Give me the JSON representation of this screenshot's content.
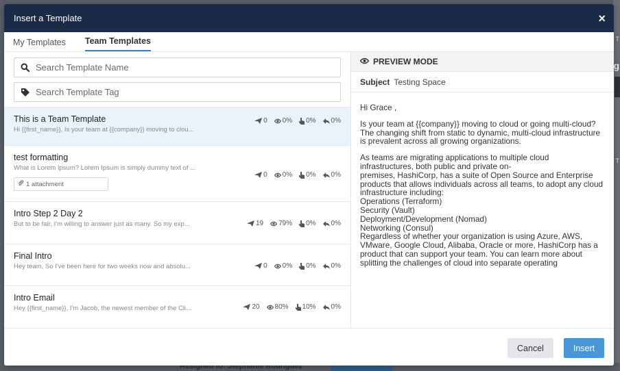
{
  "background": {
    "assigned_text": "Assigned to: Stephanie Rodriguez",
    "edge_letters": [
      "T",
      "g",
      "T"
    ]
  },
  "modal": {
    "title": "Insert a Template",
    "close_label": "×"
  },
  "tabs": [
    {
      "label": "My Templates",
      "active": false
    },
    {
      "label": "Team Templates",
      "active": true
    }
  ],
  "search": {
    "name_placeholder": "Search Template Name",
    "tag_placeholder": "Search Template Tag"
  },
  "templates": [
    {
      "title": "This is a Team Template",
      "preview": "Hi {{first_name}}, Is your team at {{company}} moving to clou...",
      "sent": "0",
      "opened": "0%",
      "clicked": "0%",
      "replied": "0%",
      "selected": true,
      "attachment": ""
    },
    {
      "title": "test formatting",
      "preview": "What is Lorem Ipsum? Lorem Ipsum is simply dummy text of ...",
      "sent": "0",
      "opened": "0%",
      "clicked": "0%",
      "replied": "0%",
      "selected": false,
      "attachment": "1 attachment"
    },
    {
      "title": "Intro Step 2 Day 2",
      "preview": "But to be fair, I'm willing to answer just as many.  So my exp...",
      "sent": "19",
      "opened": "79%",
      "clicked": "0%",
      "replied": "0%",
      "selected": false,
      "attachment": ""
    },
    {
      "title": "Final Intro",
      "preview": "Hey team, So I've been here for two weeks now and absolu...",
      "sent": "0",
      "opened": "0%",
      "clicked": "0%",
      "replied": "0%",
      "selected": false,
      "attachment": ""
    },
    {
      "title": "Intro Email",
      "preview": "Hey {{first_name}}, I'm Jacob, the newest member of the Cli...",
      "sent": "20",
      "opened": "80%",
      "clicked": "10%",
      "replied": "0%",
      "selected": false,
      "attachment": ""
    }
  ],
  "preview": {
    "header": "PREVIEW MODE",
    "subject_label": "Subject",
    "subject_value": "Testing Space",
    "greeting": "Hi Grace ,",
    "para1": "Is your team at {{company}} moving to cloud or going multi-cloud? The changing shift from static to dynamic, multi-cloud infrastructure is prevalent across all growing organizations.",
    "para2_lines": [
      "As teams are migrating applications to multiple cloud infrastructures, both public and private on-",
      "premises, HashiCorp, has a suite of Open Source and Enterprise products that allows individuals across all teams, to adopt any cloud infrastructure including:",
      "Operations (Terraform)",
      "Security (Vault)",
      "Deployment/Development (Nomad)",
      "Networking (Consul)",
      "Regardless of whether your organization is using Azure, AWS, VMware, Google Cloud, Alibaba, Oracle or more, HashiCorp has a product that can support your team. You can learn more about splitting the challenges of cloud into separate operating"
    ]
  },
  "footer": {
    "cancel_label": "Cancel",
    "insert_label": "Insert"
  },
  "colors": {
    "header_bg": "#1b2a47",
    "accent": "#2f86d6",
    "insert_bg": "#4a97d8",
    "selected_row": "#eaf3fb"
  }
}
